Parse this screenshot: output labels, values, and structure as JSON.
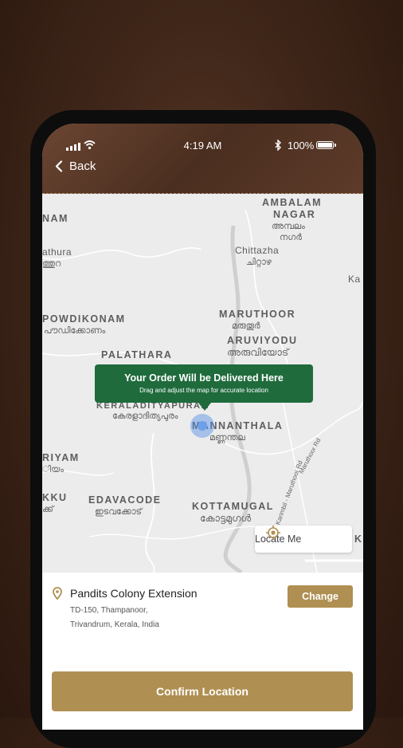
{
  "status_bar": {
    "time": "4:19 AM",
    "battery": "100%"
  },
  "header": {
    "back_label": "Back"
  },
  "map": {
    "tooltip_title": "Your Order Will be Delivered Here",
    "tooltip_subtitle": "Drag and adjust the map for accurate location",
    "locate_label": "Locate Me",
    "place_labels": {
      "nam": "NAM",
      "ambalam_1": "AMBALAM",
      "ambalam_2": "NAGAR",
      "ambalam_ml_1": "അമ്പലം",
      "ambalam_ml_2": "നഗർ",
      "athura": "athura",
      "athura_ml": "ത്തുറ",
      "chittazha": "Chittazha",
      "chittazha_ml": "ചിറ്റാഴ",
      "ka": "Ka",
      "powdikonam": "POWDIKONAM",
      "powdikonam_ml": "പൗഡിക്കോണം",
      "maruthoor": "MARUTHOOR",
      "maruthoor_ml": "മരുതൂർ",
      "aruviyodu": "ARUVIYODU",
      "aruviyodu_ml": "അരുവിയോട്",
      "palathara": "PALATHARA",
      "keraladityapuram": "KERALADITYAPURAM",
      "keraladityapuram_ml": "കേരളാദിത്യപുരം",
      "mannanthala": "MANNANTHALA",
      "mannanthala_ml": "മണ്ണന്തല",
      "riyam": "RIYAM",
      "riyam_ml": "ിയം",
      "kku": "KKU",
      "kku_ml": "ക്ക്",
      "edavacode": "EDAVACODE",
      "edavacode_ml": "ഇടവക്കോട്",
      "kottamugal": "KOTTAMUGAL",
      "kottamugal_ml": "കോട്ടമുഗൾ",
      "k_right": "K",
      "road_1": "Maruthoor Rd",
      "road_2": "Karimbil - Maruthoor Rd"
    }
  },
  "address": {
    "title": "Pandits Colony Extension",
    "line1": "TD-150, Thampanoor,",
    "line2": "Trivandrum, Kerala, India",
    "change_label": "Change"
  },
  "confirm_label": "Confirm Location",
  "colors": {
    "accent": "#b08f52",
    "tooltip": "#1f6b3c",
    "header": "#5a3a28"
  }
}
